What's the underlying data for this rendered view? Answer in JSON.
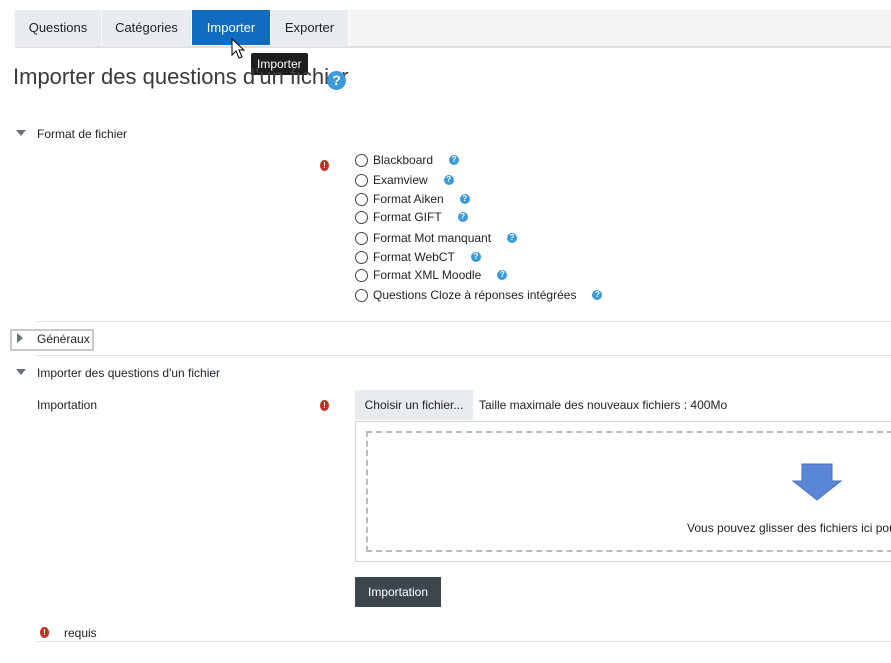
{
  "tabs": [
    {
      "label": "Questions"
    },
    {
      "label": "Catégories"
    },
    {
      "label": "Importer"
    },
    {
      "label": "Exporter"
    }
  ],
  "tooltip": "Importer",
  "page_title": "Importer des questions d'un fichier",
  "help_glyph": "?",
  "required_glyph": "!",
  "section_format": {
    "title": "Format de fichier",
    "options": [
      {
        "label": "Blackboard"
      },
      {
        "label": "Examview"
      },
      {
        "label": "Format Aiken"
      },
      {
        "label": "Format GIFT"
      },
      {
        "label": "Format Mot manquant"
      },
      {
        "label": "Format WebCT"
      },
      {
        "label": "Format XML Moodle"
      },
      {
        "label": "Questions Cloze à réponses intégrées"
      }
    ]
  },
  "section_general": {
    "title": "Généraux"
  },
  "section_import": {
    "title": "Importer des questions d'un fichier",
    "field_label": "Importation",
    "choose_button": "Choisir un fichier...",
    "max_size": "Taille maximale des nouveaux fichiers : 400Mo",
    "drop_text": "Vous pouvez glisser des fichiers ici pour"
  },
  "submit_label": "Importation",
  "required_note": "requis",
  "colors": {
    "accent": "#0f6cbf",
    "required": "#c1311e",
    "help": "#3b9ad9",
    "dark_button": "#3d464d",
    "drop_arrow": "#5a86d6"
  }
}
